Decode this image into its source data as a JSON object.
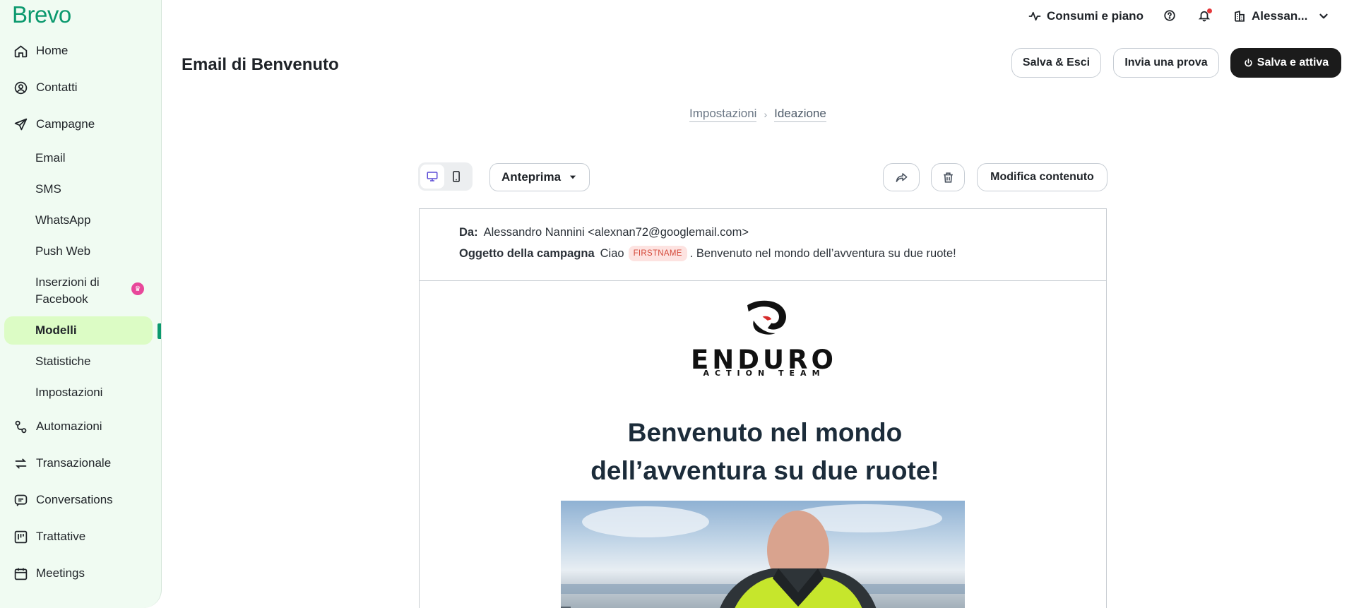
{
  "brand": {
    "logo_text": "Brevo"
  },
  "sidebar": {
    "items": [
      {
        "label": "Home",
        "icon": "home-icon"
      },
      {
        "label": "Contatti",
        "icon": "user-circle-icon"
      },
      {
        "label": "Campagne",
        "icon": "send-icon"
      },
      {
        "label": "Automazioni",
        "icon": "automation-icon"
      },
      {
        "label": "Transazionale",
        "icon": "arrows-icon"
      },
      {
        "label": "Conversations",
        "icon": "chat-icon"
      },
      {
        "label": "Trattative",
        "icon": "board-icon"
      },
      {
        "label": "Meetings",
        "icon": "calendar-icon"
      }
    ],
    "campaign_subitems": [
      "Email",
      "SMS",
      "WhatsApp",
      "Push Web",
      "Inserzioni di Facebook",
      "Modelli",
      "Statistiche",
      "Impostazioni"
    ],
    "active_subitem": "Modelli"
  },
  "topbar": {
    "usage_label": "Consumi e piano",
    "account_label": "Alessan..."
  },
  "page": {
    "title": "Email di Benvenuto",
    "save_exit": "Salva & Esci",
    "send_test": "Invia una prova",
    "save_activate": "Salva e attiva"
  },
  "breadcrumb": {
    "step1": "Impostazioni",
    "step2": "Ideazione"
  },
  "toolbar": {
    "preview_select": "Anteprima",
    "edit_content": "Modifica contenuto"
  },
  "email": {
    "from_label": "Da:",
    "from_value": "Alessandro Nannini <alexnan72@googlemail.com>",
    "subject_label": "Oggetto della campagna",
    "subject_prefix": "Ciao",
    "subject_tag": "FIRSTNAME",
    "subject_suffix": ". Benvenuto nel mondo dell’avventura su due ruote!",
    "logo_name": "ENDURO",
    "logo_tagline": "ACTION TEAM",
    "headline_line1": "Benvenuto nel mondo",
    "headline_line2": "dell’avventura su due ruote!"
  },
  "colors": {
    "brand_green": "#0b996e",
    "sidebar_bg": "#f0fbf2",
    "active_bg": "#dcfcc5",
    "primary_button": "#1b1b1b",
    "tag_bg": "#fde3e1",
    "tag_text": "#d4493a"
  }
}
